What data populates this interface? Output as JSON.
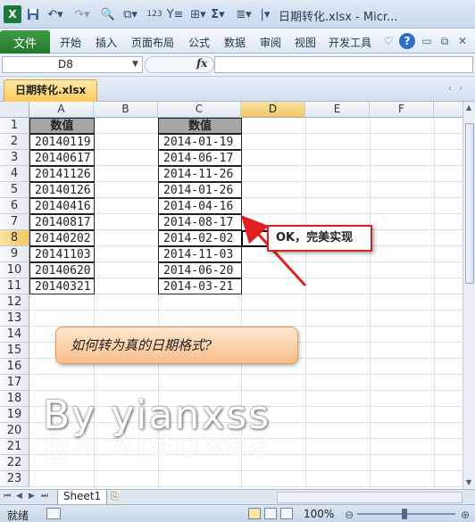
{
  "window": {
    "title": "日期转化.xlsx - Micr...",
    "app_icon_label": "X"
  },
  "quick_access": {
    "save_icon": "save-icon",
    "undo_icon": "undo-icon",
    "redo_icon": "redo-icon"
  },
  "ribbon": {
    "file_tab": "文件",
    "tabs": [
      "开始",
      "插入",
      "页面布局",
      "公式",
      "数据",
      "审阅",
      "视图",
      "开发工具"
    ]
  },
  "formula_bar": {
    "name_box": "D8",
    "fx_label": "fx",
    "formula": ""
  },
  "workbook": {
    "tab_label": "日期转化.xlsx"
  },
  "grid": {
    "columns": [
      "A",
      "B",
      "C",
      "D",
      "E",
      "F"
    ],
    "active_column": "D",
    "rows": [
      "1",
      "2",
      "3",
      "4",
      "5",
      "6",
      "7",
      "8",
      "9",
      "10",
      "11",
      "12",
      "13",
      "14",
      "15",
      "16",
      "17",
      "18",
      "19",
      "20",
      "21",
      "22",
      "23"
    ],
    "active_row": "8",
    "col_a_header": "数值",
    "col_c_header": "数值",
    "col_a_values": [
      "20140119",
      "20140617",
      "20141126",
      "20140126",
      "20140416",
      "20140817",
      "20140202",
      "20141103",
      "20140620",
      "20140321"
    ],
    "col_c_values": [
      "2014-01-19",
      "2014-06-17",
      "2014-11-26",
      "2014-01-26",
      "2014-04-16",
      "2014-08-17",
      "2014-02-02",
      "2014-11-03",
      "2014-06-20",
      "2014-03-21"
    ]
  },
  "annotations": {
    "callout": "OK，完美实现",
    "question": "如何转为真的日期格式?",
    "watermark": "By yianxss"
  },
  "sheets": {
    "tabs": [
      "Sheet1"
    ]
  },
  "status": {
    "ready": "就绪",
    "zoom": "100%"
  },
  "colors": {
    "header_fill": "#a6a6a6",
    "callout_border": "#e02020",
    "arrow": "#e02020",
    "question_fill": "#f8bf8b",
    "file_tab": "#257a2d"
  }
}
